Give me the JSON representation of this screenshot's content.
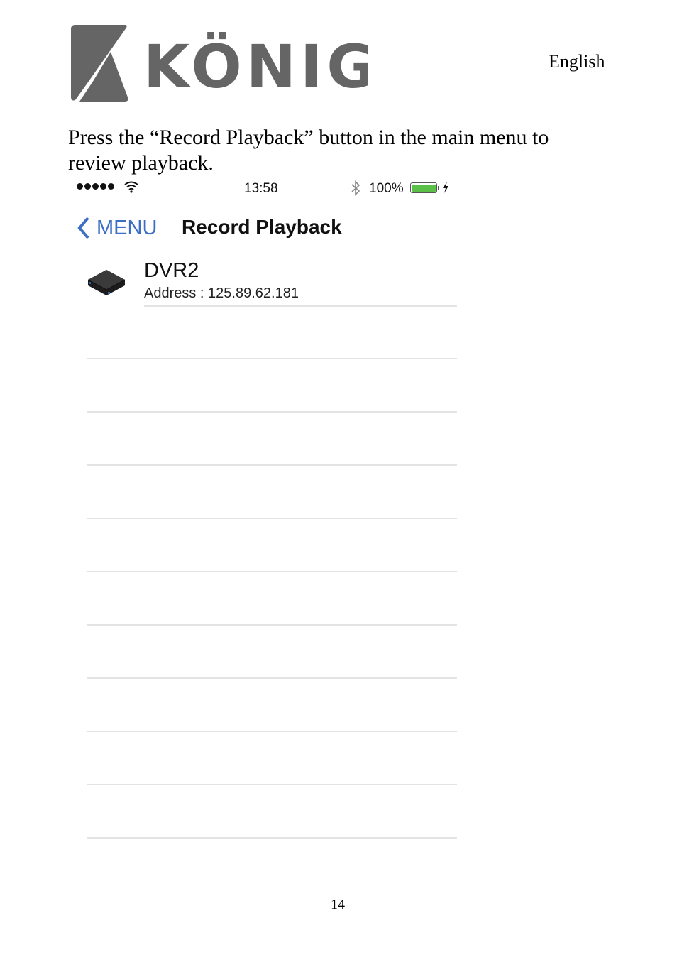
{
  "header": {
    "brand": "KÖNIG",
    "language": "English"
  },
  "instruction": "Press the “Record Playback” button in the main menu to review playback.",
  "phone": {
    "status_bar": {
      "signal_icon": "signal-dots-icon",
      "wifi_icon": "wifi-icon",
      "time": "13:58",
      "bluetooth_icon": "bluetooth-icon",
      "battery_percent": "100%",
      "battery_level": 1.0,
      "battery_color": "#5ac048",
      "charging_icon": "lightning-bolt-icon"
    },
    "nav_bar": {
      "back_label": "MENU",
      "title": "Record Playback",
      "accent_color": "#3b6fc4"
    },
    "devices": [
      {
        "name": "DVR2",
        "address": "Address : 125.89.62.181",
        "icon": "dvr-box-icon"
      }
    ],
    "empty_rows": 10
  },
  "footer": {
    "page_number": "14"
  }
}
